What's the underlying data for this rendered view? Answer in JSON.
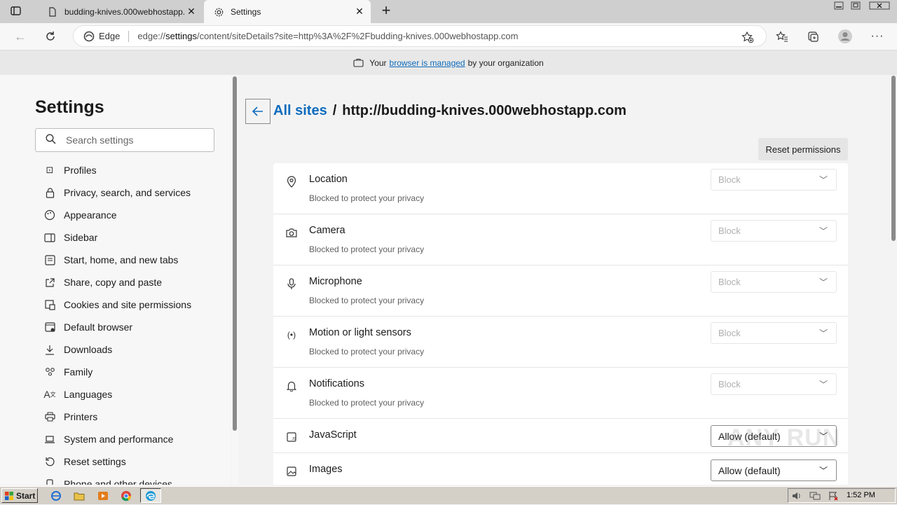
{
  "tabs": [
    {
      "title": "budding-knives.000webhostapp.com",
      "icon": "page-icon",
      "active": false
    },
    {
      "title": "Settings",
      "icon": "gear-icon",
      "active": true
    }
  ],
  "toolbar": {
    "edge_label": "Edge",
    "url_prefix": "edge://",
    "url_bold": "settings",
    "url_rest": "/content/siteDetails?site=http%3A%2F%2Fbudding-knives.000webhostapp.com"
  },
  "managed_banner": {
    "before": "Your",
    "link": "browser is managed",
    "after": "by your organization"
  },
  "sidebar": {
    "title": "Settings",
    "search_placeholder": "Search settings",
    "items": [
      {
        "label": "Profiles",
        "icon": "profile-icon"
      },
      {
        "label": "Privacy, search, and services",
        "icon": "lock-icon"
      },
      {
        "label": "Appearance",
        "icon": "palette-icon"
      },
      {
        "label": "Sidebar",
        "icon": "sidebar-icon"
      },
      {
        "label": "Start, home, and new tabs",
        "icon": "home-tabs-icon"
      },
      {
        "label": "Share, copy and paste",
        "icon": "share-icon"
      },
      {
        "label": "Cookies and site permissions",
        "icon": "cookies-icon"
      },
      {
        "label": "Default browser",
        "icon": "browser-icon"
      },
      {
        "label": "Downloads",
        "icon": "download-icon"
      },
      {
        "label": "Family",
        "icon": "family-icon"
      },
      {
        "label": "Languages",
        "icon": "languages-icon"
      },
      {
        "label": "Printers",
        "icon": "printer-icon"
      },
      {
        "label": "System and performance",
        "icon": "laptop-icon"
      },
      {
        "label": "Reset settings",
        "icon": "reset-icon"
      },
      {
        "label": "Phone and other devices",
        "icon": "phone-icon"
      }
    ]
  },
  "main": {
    "breadcrumb_link": "All sites",
    "breadcrumb_sep": "/",
    "breadcrumb_site": "http://budding-knives.000webhostapp.com",
    "reset_label": "Reset permissions",
    "permissions": [
      {
        "title": "Location",
        "subtitle": "Blocked to protect your privacy",
        "value": "Block",
        "enabled": false,
        "icon": "location-icon"
      },
      {
        "title": "Camera",
        "subtitle": "Blocked to protect your privacy",
        "value": "Block",
        "enabled": false,
        "icon": "camera-icon"
      },
      {
        "title": "Microphone",
        "subtitle": "Blocked to protect your privacy",
        "value": "Block",
        "enabled": false,
        "icon": "microphone-icon"
      },
      {
        "title": "Motion or light sensors",
        "subtitle": "Blocked to protect your privacy",
        "value": "Block",
        "enabled": false,
        "icon": "sensor-icon"
      },
      {
        "title": "Notifications",
        "subtitle": "Blocked to protect your privacy",
        "value": "Block",
        "enabled": false,
        "icon": "bell-icon"
      },
      {
        "title": "JavaScript",
        "subtitle": "",
        "value": "Allow (default)",
        "enabled": true,
        "icon": "javascript-icon"
      },
      {
        "title": "Images",
        "subtitle": "",
        "value": "Allow (default)",
        "enabled": true,
        "icon": "image-icon"
      }
    ]
  },
  "watermark": "ANY RUN",
  "taskbar": {
    "start_label": "Start",
    "clock": "1:52 PM"
  },
  "colors": {
    "accent": "#0f6cbd",
    "taskbar": "#d4d0c8"
  }
}
